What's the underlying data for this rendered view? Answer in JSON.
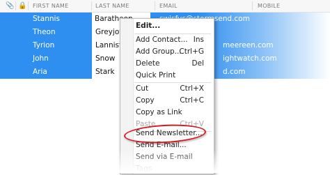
{
  "header": {
    "first_name": "FIRST NAME",
    "last_name": "LAST NAME",
    "email": "EMAIL",
    "mobile": "MOBILE",
    "attachment_icon": "paperclip-icon",
    "lock_icon": "lock-icon"
  },
  "rows": [
    {
      "first": "Stannis",
      "last": "Baratheon",
      "email": "swisfyc@stormsend.com"
    },
    {
      "first": "Theon",
      "last": "Greyjoy",
      "email": ""
    },
    {
      "first": "Tyrion",
      "last": "Lannister",
      "email": "meereen.com"
    },
    {
      "first": "John",
      "last": "Snow",
      "email": "ightwatch.com"
    },
    {
      "first": "Aria",
      "last": "Stark",
      "email": "d.com"
    }
  ],
  "editing_value": "Baratheon",
  "menu": {
    "items": [
      {
        "label": "Edit...",
        "shortcut": ""
      },
      {
        "label": "Add Contact...",
        "shortcut": "Ins"
      },
      {
        "label": "Add Group...",
        "shortcut": "Ctrl+G"
      },
      {
        "label": "Delete",
        "shortcut": "Del"
      },
      {
        "label": "Quick Print",
        "shortcut": ""
      },
      {
        "label": "Cut",
        "shortcut": "Ctrl+X"
      },
      {
        "label": "Copy",
        "shortcut": "Ctrl+C"
      },
      {
        "label": "Copy as Link",
        "shortcut": ""
      },
      {
        "label": "Paste",
        "shortcut": "Ctrl+V"
      },
      {
        "label": "Send Newsletter...",
        "shortcut": ""
      },
      {
        "label": "Send E-mail...",
        "shortcut": ""
      },
      {
        "label": "Send via E-mail",
        "shortcut": ""
      },
      {
        "label": "Tags",
        "shortcut": ""
      }
    ]
  },
  "colors": {
    "selection": "#2f8ff0",
    "annotation_ring": "#d9191f"
  }
}
